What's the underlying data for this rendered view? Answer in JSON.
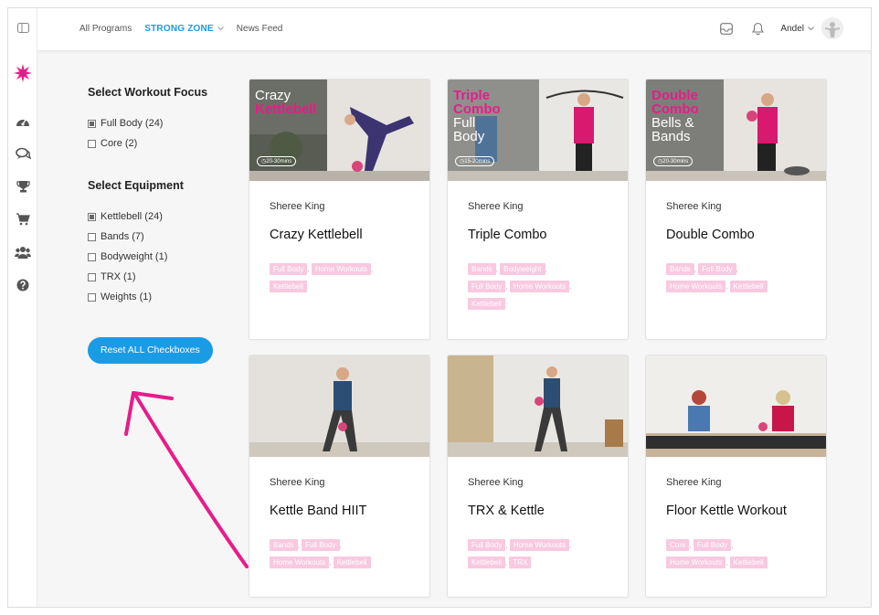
{
  "header": {
    "nav": [
      {
        "label": "All Programs"
      },
      {
        "label": "STRONG ZONE"
      },
      {
        "label": "News Feed"
      }
    ],
    "user_name": "Andel"
  },
  "filters": {
    "focus_title": "Select Workout Focus",
    "focus": [
      {
        "label": "Full Body (24)",
        "checked": true
      },
      {
        "label": "Core (2)",
        "checked": false
      }
    ],
    "equipment_title": "Select Equipment",
    "equipment": [
      {
        "label": "Kettlebell (24)",
        "checked": true
      },
      {
        "label": "Bands (7)",
        "checked": false
      },
      {
        "label": "Bodyweight (1)",
        "checked": false
      },
      {
        "label": "TRX (1)",
        "checked": false
      },
      {
        "label": "Weights (1)",
        "checked": false
      }
    ],
    "reset_label": "Reset ALL Checkboxes"
  },
  "cards": [
    {
      "author": "Sheree King",
      "title": "Crazy Kettlebell",
      "overlay_white": "Crazy",
      "overlay_pink": "Kettlebell",
      "overlay_rest": "",
      "duration": "20-30mins",
      "tags": [
        "Full Body",
        "Home Workouts",
        "Kettlebell"
      ]
    },
    {
      "author": "Sheree King",
      "title": "Triple Combo",
      "overlay_white": "",
      "overlay_pink": "Triple Combo",
      "overlay_rest": "Full Body",
      "duration": "15-20mins",
      "tags": [
        "Bands",
        "Bodyweight",
        "Full Body",
        "Home Workouts",
        "Kettlebell"
      ]
    },
    {
      "author": "Sheree King",
      "title": "Double Combo",
      "overlay_white": "",
      "overlay_pink": "Double Combo",
      "overlay_rest": "Bells & Bands",
      "duration": "20-30mins",
      "tags": [
        "Bands",
        "Full Body",
        "Home Workouts",
        "Kettlebell"
      ]
    },
    {
      "author": "Sheree King",
      "title": "Kettle Band HIIT",
      "tags": [
        "Bands",
        "Full Body",
        "Home Workouts",
        "Kettlebell"
      ]
    },
    {
      "author": "Sheree King",
      "title": "TRX & Kettle",
      "tags": [
        "Full Body",
        "Home Workouts",
        "Kettlebell",
        "TRX"
      ]
    },
    {
      "author": "Sheree King",
      "title": "Floor Kettle Workout",
      "tags": [
        "Core",
        "Full Body",
        "Home Workouts",
        "Kettlebell"
      ]
    }
  ],
  "colors": {
    "accent": "#1a9be6",
    "brand_pink": "#e81b8a",
    "tag_bg": "#f8c9e0"
  }
}
